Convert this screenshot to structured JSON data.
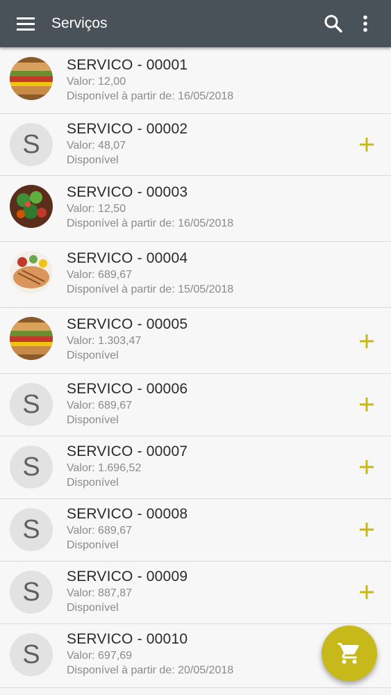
{
  "appbar": {
    "title": "Serviços",
    "icons": [
      "menu-icon",
      "search-icon",
      "more-vert-icon"
    ]
  },
  "colors": {
    "appbar": "#4a5259",
    "accent": "#c8b91a",
    "avatar_placeholder": "#e2e2e2"
  },
  "items": [
    {
      "name": "SERVICO - 00001",
      "value": "Valor: 12,00",
      "availability": "Disponível à partir de: 16/05/2018",
      "avatar": "burger-image",
      "addable": false
    },
    {
      "name": "SERVICO - 00002",
      "value": "Valor: 48,07",
      "availability": "Disponível",
      "avatar_letter": "S",
      "addable": true
    },
    {
      "name": "SERVICO - 00003",
      "value": "Valor: 12,50",
      "availability": "Disponível à partir de: 16/05/2018",
      "avatar": "salad-image",
      "addable": false
    },
    {
      "name": "SERVICO - 00004",
      "value": "Valor: 689,67",
      "availability": "Disponível à partir de: 15/05/2018",
      "avatar": "grilled-meat-image",
      "addable": false
    },
    {
      "name": "SERVICO - 00005",
      "value": "Valor: 1.303,47",
      "availability": "Disponível",
      "avatar": "burger-image",
      "addable": true
    },
    {
      "name": "SERVICO - 00006",
      "value": "Valor: 689,67",
      "availability": "Disponível",
      "avatar_letter": "S",
      "addable": true
    },
    {
      "name": "SERVICO - 00007",
      "value": "Valor: 1.696,52",
      "availability": "Disponível",
      "avatar_letter": "S",
      "addable": true
    },
    {
      "name": "SERVICO - 00008",
      "value": "Valor: 689,67",
      "availability": "Disponível",
      "avatar_letter": "S",
      "addable": true
    },
    {
      "name": "SERVICO - 00009",
      "value": "Valor: 887,87",
      "availability": "Disponível",
      "avatar_letter": "S",
      "addable": true
    },
    {
      "name": "SERVICO - 00010",
      "value": "Valor: 697,69",
      "availability": "Disponível à partir de: 20/05/2018",
      "avatar_letter": "S",
      "addable": false
    }
  ],
  "fab": {
    "icon": "shopping-cart-icon"
  }
}
